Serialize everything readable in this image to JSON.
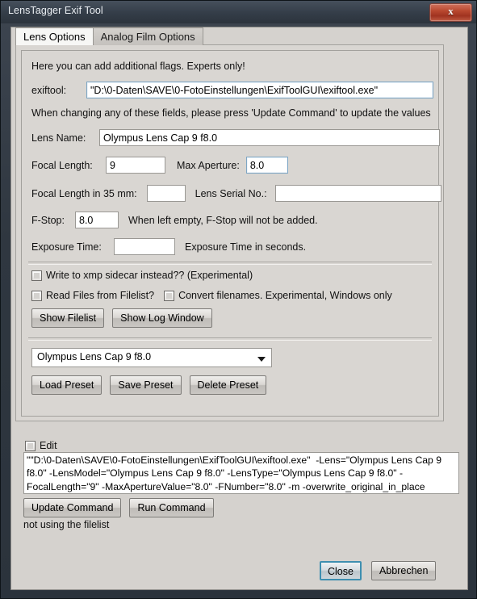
{
  "window": {
    "title": "LensTagger Exif Tool",
    "close_glyph": "x",
    "close_name": "window-close"
  },
  "tabs": [
    {
      "label": "Lens Options",
      "active": true
    },
    {
      "label": "Analog Film Options",
      "active": false
    }
  ],
  "lens_options": {
    "flags_hint": "Here you can add additional flags. Experts only!",
    "exiftool_label": "exiftool:",
    "exiftool_value": "\"D:\\0-Daten\\SAVE\\0-FotoEinstellungen\\ExifToolGUI\\exiftool.exe\"",
    "exiftool_placeholder": "",
    "update_hint": "When changing any of these fields, please press 'Update Command' to update the values",
    "lens_name_label": "Lens Name:",
    "lens_name_value": "Olympus Lens Cap 9 f8.0",
    "focal_length_label": "Focal Length:",
    "focal_length_value": "9",
    "max_aperture_label": "Max Aperture:",
    "max_aperture_value": "8.0",
    "focal_length_35_label": "Focal Length in 35 mm:",
    "focal_length_35_value": "",
    "lens_serial_label": "Lens Serial No.:",
    "lens_serial_value": "",
    "fstop_label": "F-Stop:",
    "fstop_value": "8.0",
    "fstop_hint": "When left empty, F-Stop will not be added.",
    "exposure_time_label": "Exposure Time:",
    "exposure_time_value": "",
    "exposure_time_hint": "Exposure Time in seconds.",
    "xmp_sidecar_label": "Write to xmp sidecar instead?? (Experimental)",
    "read_filelist_label": "Read Files from Filelist?",
    "convert_filenames_label": "Convert filenames. Experimental, Windows only",
    "show_filelist_button": "Show Filelist",
    "show_log_button": "Show Log Window",
    "preset_selected": "Olympus Lens Cap 9 f8.0",
    "load_preset_button": "Load Preset",
    "save_preset_button": "Save Preset",
    "delete_preset_button": "Delete Preset"
  },
  "command_area": {
    "edit_label": "Edit",
    "command_text": "\"\"D:\\0-Daten\\SAVE\\0-FotoEinstellungen\\ExifToolGUI\\exiftool.exe\"  -Lens=\"Olympus Lens Cap 9 f8.0\" -LensModel=\"Olympus Lens Cap 9 f8.0\" -LensType=\"Olympus Lens Cap 9 f8.0\" -FocalLength=\"9\" -MaxApertureValue=\"8.0\" -FNumber=\"8.0\" -m -overwrite_original_in_place",
    "update_command_button": "Update Command",
    "run_command_button": "Run Command",
    "status_text": "not using the filelist"
  },
  "footer": {
    "close_button": "Close",
    "cancel_button": "Abbrechen"
  },
  "colors": {
    "accent_focus": "#3e8fb0",
    "close_red": "#b9482f",
    "window_chrome": "#343d48",
    "client_bg": "#d5d2ce"
  }
}
